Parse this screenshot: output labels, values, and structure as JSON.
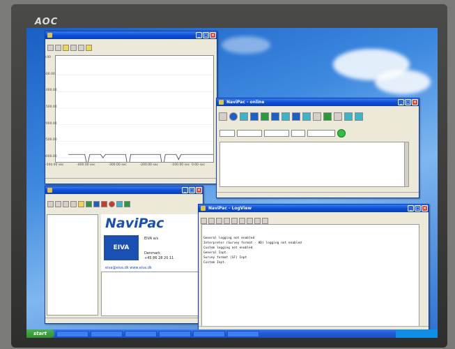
{
  "monitor": {
    "brand": "AOC"
  },
  "windows": {
    "navipac_info": {
      "product": "NaviPac",
      "company_logo": "EIVA",
      "address": [
        "EIVA a/s",
        "Denmark",
        "+45 86 28 20 11"
      ],
      "web": "eiva@eiva.dk  www.eiva.dk"
    },
    "online": {
      "title": "NaviPac - online"
    },
    "log": {
      "title": "NaviPac - LogView",
      "lines": [
        "General logging not enabled",
        "Interpreter (Survey format - HD) logging not enabled",
        "Custom logging not enabled",
        "General Inpt.",
        "Survey format (SF) Inpt",
        "Custom Inpt."
      ]
    }
  },
  "depth_chart": {
    "type": "line",
    "y_labels": [
      "0.00",
      "500.00",
      "1000.00",
      "1500.00",
      "2000.00",
      "2500.00",
      "3000.00"
    ],
    "x_labels": [
      "-500.00 sec",
      "-400.00 sec",
      "-300.00 sec",
      "-200.00 sec",
      "-100.00 sec",
      "0.00 sec"
    ],
    "spikes": [
      {
        "t": -400,
        "depth": 3250
      },
      {
        "t": -350,
        "depth": 3000
      },
      {
        "t": -270,
        "depth": 3400
      },
      {
        "t": -160,
        "depth": 3350
      },
      {
        "t": -110,
        "depth": 3050
      }
    ],
    "baseline_depth": 2900,
    "xlim": [
      -500,
      0
    ],
    "ylim": [
      0,
      3000
    ],
    "colors": {
      "line": "#404040"
    }
  },
  "taskbar": {
    "start_label": "start"
  }
}
